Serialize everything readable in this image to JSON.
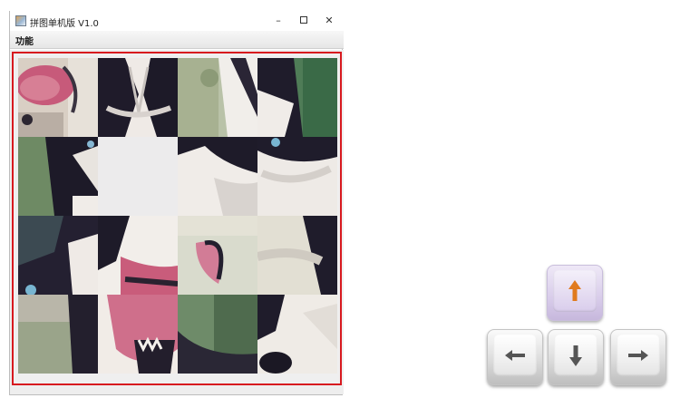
{
  "window": {
    "title": "拼图单机版 V1.0",
    "controls": {
      "minimize": "–",
      "close": "✕"
    }
  },
  "menubar": {
    "items": [
      {
        "label": "功能"
      }
    ]
  },
  "puzzle": {
    "grid": "4x4",
    "blank_position": [
      1,
      1
    ],
    "border_color": "#d7191f",
    "blank_color": "#ecebec"
  },
  "arrow_keys": [
    {
      "direction": "up",
      "icon": "arrow-up-icon",
      "arrow_color": "#e07a1e",
      "highlighted": true
    },
    {
      "direction": "left",
      "icon": "arrow-left-icon",
      "arrow_color": "#555555",
      "highlighted": false
    },
    {
      "direction": "down",
      "icon": "arrow-down-icon",
      "arrow_color": "#555555",
      "highlighted": false
    },
    {
      "direction": "right",
      "icon": "arrow-right-icon",
      "arrow_color": "#555555",
      "highlighted": false
    }
  ]
}
